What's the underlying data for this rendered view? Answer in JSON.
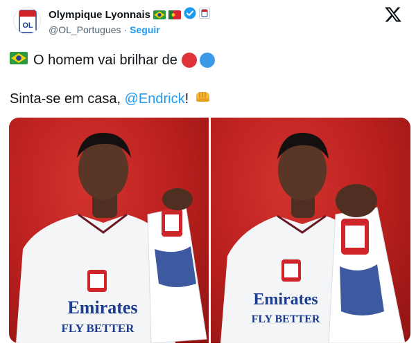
{
  "account": {
    "display_name": "Olympique Lyonnais",
    "handle": "@OL_Portugues",
    "separator": "·",
    "follow_label": "Seguir",
    "avatar_text": "OL"
  },
  "tweet": {
    "line1_text": "O homem vai brilhar de",
    "line2_prefix": "Sinta-se em casa, ",
    "line2_mention": "@Endrick",
    "line2_suffix": "!"
  },
  "media": {
    "photo1_shirt_text": "Emirates",
    "photo1_shirt_sub": "FLY BETTER",
    "photo2_shirt_text": "Emirates",
    "photo2_shirt_sub": "FLY BETTER"
  },
  "colors": {
    "accent": "#1d9bf0",
    "verified": "#1d9bf0",
    "circle_red": "#e0323a",
    "circle_blue": "#3c9ae8",
    "backdrop_red": "#c2221f"
  }
}
